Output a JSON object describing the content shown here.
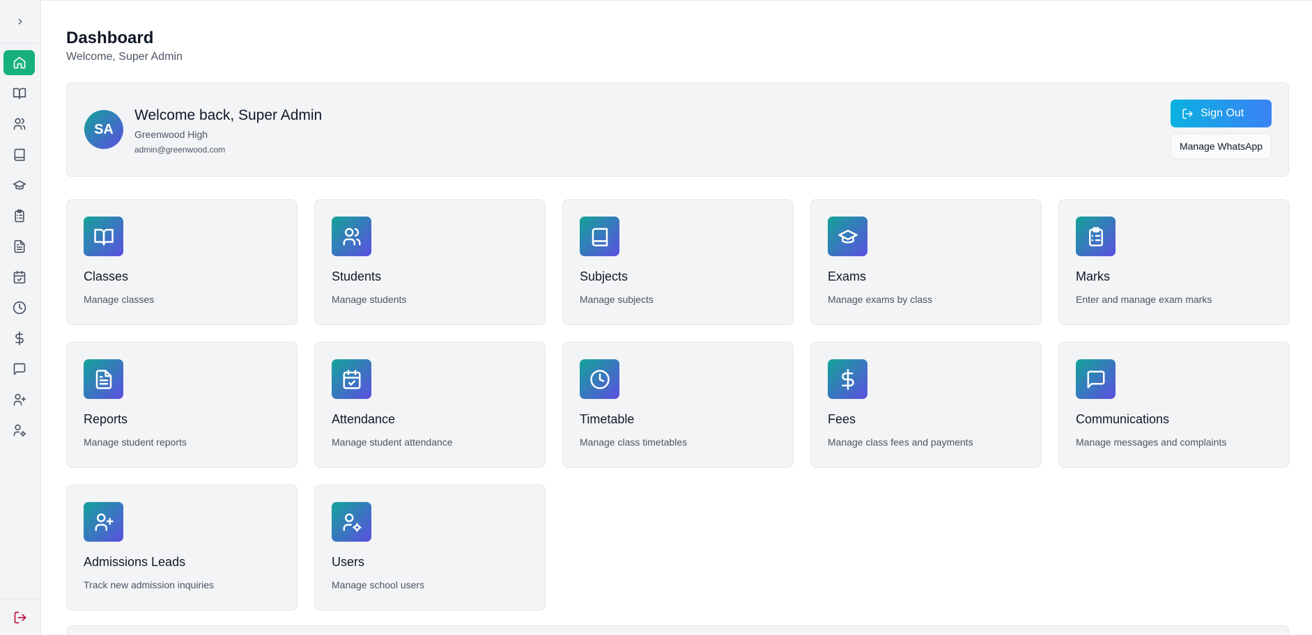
{
  "header": {
    "title": "Dashboard",
    "subtitle": "Welcome, Super Admin"
  },
  "sidebar": {
    "toggle_icon": "chevron-right-icon",
    "items": [
      {
        "icon": "home-icon",
        "active": true
      },
      {
        "icon": "book-open-icon"
      },
      {
        "icon": "users-icon"
      },
      {
        "icon": "book-icon"
      },
      {
        "icon": "graduation-cap-icon"
      },
      {
        "icon": "clipboard-list-icon"
      },
      {
        "icon": "file-text-icon"
      },
      {
        "icon": "calendar-check-icon"
      },
      {
        "icon": "clock-icon"
      },
      {
        "icon": "dollar-icon"
      },
      {
        "icon": "message-icon"
      },
      {
        "icon": "user-plus-icon"
      },
      {
        "icon": "user-cog-icon"
      }
    ],
    "logout_icon": "logout-icon"
  },
  "welcome": {
    "initials": "SA",
    "name": "Welcome back, Super Admin",
    "school": "Greenwood High",
    "email": "admin@greenwood.com",
    "signout_label": "Sign Out",
    "whatsapp_label": "Manage WhatsApp"
  },
  "cards": [
    {
      "title": "Classes",
      "desc": "Manage classes",
      "icon": "book-open-icon"
    },
    {
      "title": "Students",
      "desc": "Manage students",
      "icon": "users-icon"
    },
    {
      "title": "Subjects",
      "desc": "Manage subjects",
      "icon": "book-icon"
    },
    {
      "title": "Exams",
      "desc": "Manage exams by class",
      "icon": "graduation-cap-icon"
    },
    {
      "title": "Marks",
      "desc": "Enter and manage exam marks",
      "icon": "clipboard-list-icon"
    },
    {
      "title": "Reports",
      "desc": "Manage student reports",
      "icon": "file-text-icon"
    },
    {
      "title": "Attendance",
      "desc": "Manage student attendance",
      "icon": "calendar-check-icon"
    },
    {
      "title": "Timetable",
      "desc": "Manage class timetables",
      "icon": "clock-icon"
    },
    {
      "title": "Fees",
      "desc": "Manage class fees and payments",
      "icon": "dollar-icon"
    },
    {
      "title": "Communications",
      "desc": "Manage messages and complaints",
      "icon": "message-icon"
    },
    {
      "title": "Admissions Leads",
      "desc": "Track new admission inquiries",
      "icon": "user-plus-icon"
    },
    {
      "title": "Users",
      "desc": "Manage school users",
      "icon": "user-cog-icon"
    }
  ],
  "colors": {
    "active_nav": "#16b17a",
    "gradient_start": "#14a39a",
    "gradient_end": "#5b4fe0",
    "signout_start": "#0ab1e0",
    "signout_end": "#3b82f6",
    "logout": "#be123c"
  }
}
